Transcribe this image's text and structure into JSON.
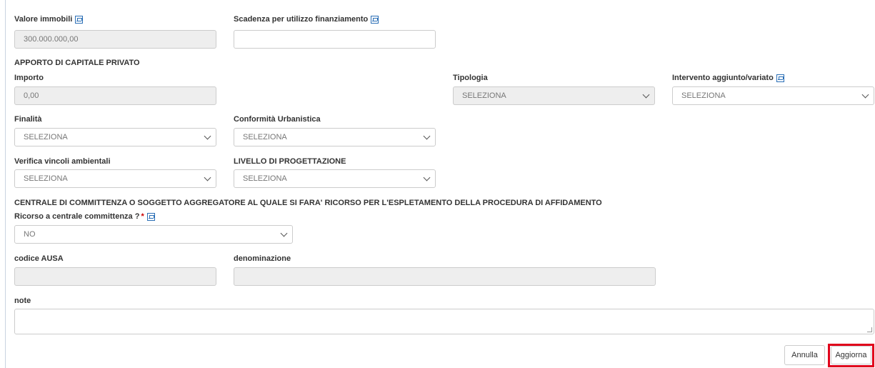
{
  "fields": {
    "valore_immobili": {
      "label": "Valore immobili",
      "value": "300.000.000,00"
    },
    "scadenza": {
      "label": "Scadenza per utilizzo finanziamento",
      "value": ""
    },
    "apporto_section": "APPORTO DI CAPITALE PRIVATO",
    "importo": {
      "label": "Importo",
      "value": "0,00"
    },
    "tipologia": {
      "label": "Tipologia",
      "value": "SELEZIONA"
    },
    "intervento": {
      "label": "Intervento aggiunto/variato",
      "value": "SELEZIONA"
    },
    "finalita": {
      "label": "Finalità",
      "value": "SELEZIONA"
    },
    "conformita": {
      "label": "Conformità Urbanistica",
      "value": "SELEZIONA"
    },
    "verifica": {
      "label": "Verifica vincoli ambientali",
      "value": "SELEZIONA"
    },
    "livello": {
      "label": "LIVELLO DI PROGETTAZIONE",
      "value": "SELEZIONA"
    },
    "centrale_section": "CENTRALE DI COMMITTENZA O SOGGETTO AGGREGATORE AL QUALE SI FARA' RICORSO PER L'ESPLETAMENTO DELLA PROCEDURA DI AFFIDAMENTO",
    "ricorso": {
      "label": "Ricorso a centrale committenza ?",
      "required_mark": "*",
      "value": "NO"
    },
    "codice_ausa": {
      "label": "codice AUSA",
      "value": ""
    },
    "denominazione": {
      "label": "denominazione",
      "value": ""
    },
    "note": {
      "label": "note",
      "value": ""
    }
  },
  "buttons": {
    "annulla": "Annulla",
    "aggiorna": "Aggiorna"
  },
  "icons": {
    "info": "info-screen-icon",
    "dropdown": "chevron-down-icon"
  },
  "colors": {
    "highlight": "#e0001b",
    "disabled_bg": "#eeeeee",
    "icon_blue": "#2b6fb6"
  }
}
